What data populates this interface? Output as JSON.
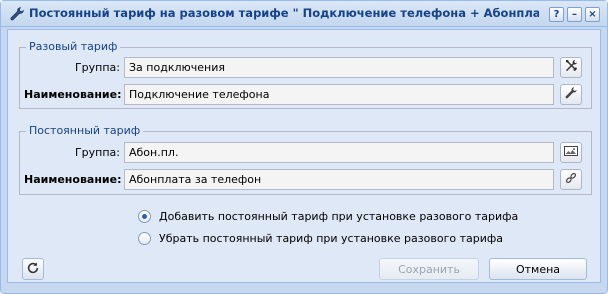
{
  "window": {
    "title": "Постоянный тариф на разовом тарифе \" Подключение телефона + Абонплата за теле..."
  },
  "tools": {
    "help": "?",
    "minimize": "–",
    "close": "×"
  },
  "one_time_tariff": {
    "legend": "Разовый тариф",
    "group_label": "Группа:",
    "group_value": "За подключения",
    "name_label": "Наименование:",
    "name_value": "Подключение телефона"
  },
  "permanent_tariff": {
    "legend": "Постоянный тариф",
    "group_label": "Группа:",
    "group_value": "Абон.пл.",
    "name_label": "Наименование:",
    "name_value": "Абонплата за телефон"
  },
  "options": [
    {
      "label": "Добавить постоянный тариф при установке разового тарифа",
      "selected": true
    },
    {
      "label": "Убрать постоянный тариф при установке разового тарифа",
      "selected": false
    }
  ],
  "buttons": {
    "save_label": "Сохранить",
    "cancel_label": "Отмена"
  },
  "icons": {
    "title": "wrench-icon",
    "group_trigger": "tools-icon",
    "name_trigger": "wrench-icon",
    "perm_group_trigger": "folder-image-icon",
    "perm_name_trigger": "link-icon",
    "refresh": "refresh-icon"
  },
  "colors": {
    "title_text": "#15428b",
    "panel_bg": "#dfe8f6",
    "border": "#99bbe8"
  }
}
